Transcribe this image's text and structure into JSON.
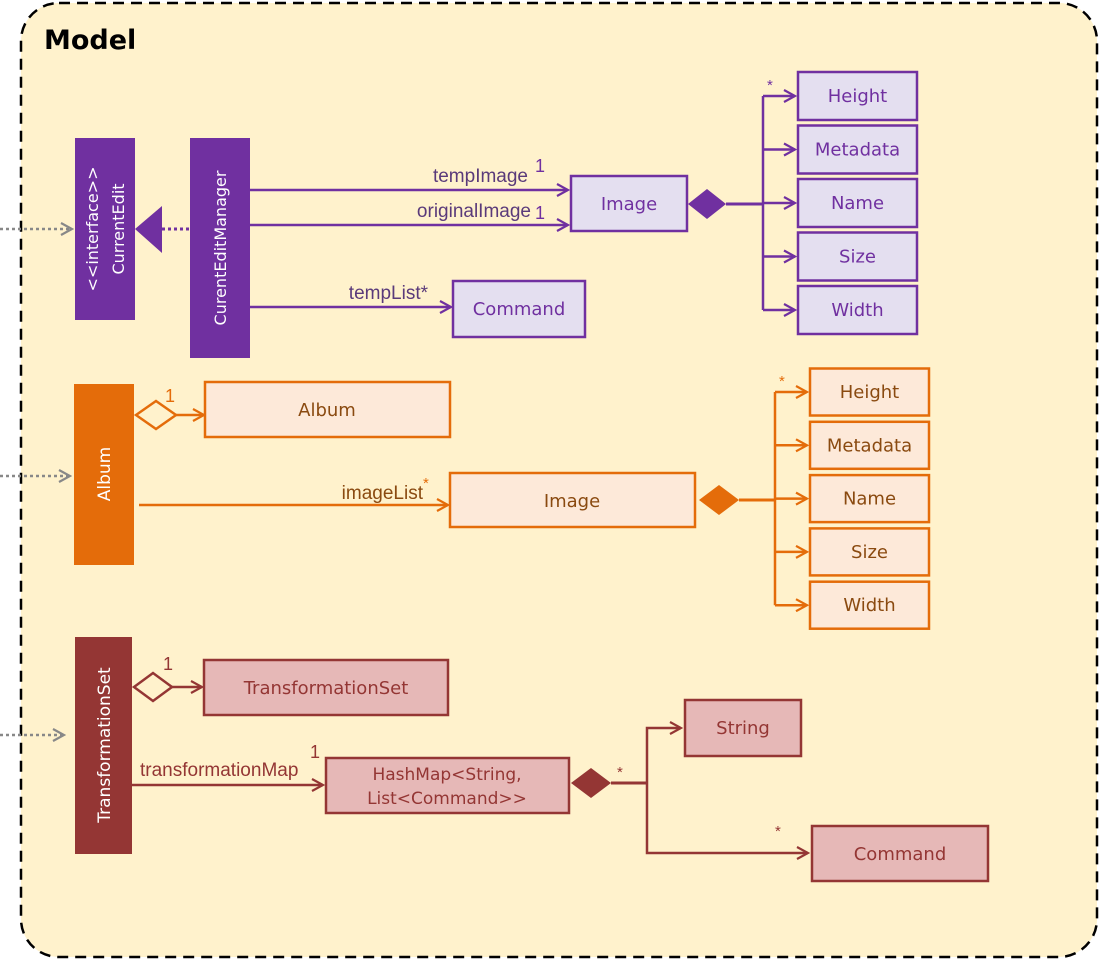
{
  "title": "Model",
  "colors": {
    "background": "#fff2cc",
    "border": "#000000",
    "external_arrow": "#888888",
    "purple": "#7030a0",
    "purple_fill": "#e4dff0",
    "purple_text": "#7030a0",
    "purple_label": "#5a3a7a",
    "orange": "#e46c0a",
    "orange_fill": "#fde9d9",
    "orange_text": "#8a4a10",
    "red": "#943634",
    "red_fill": "#e6b8b7",
    "red_text": "#943634"
  },
  "sections": {
    "current_edit": {
      "interface": {
        "stereotype": "<<interface>>",
        "name": "CurrentEdit"
      },
      "manager": {
        "name": "CurentEditManager"
      },
      "image": {
        "name": "Image"
      },
      "command": {
        "name": "Command"
      },
      "assoc_temp_image": {
        "label": "tempImage",
        "multiplicity": "1"
      },
      "assoc_original_image": {
        "label": "originalImage",
        "multiplicity": "1"
      },
      "assoc_temp_list": {
        "label": "tempList*"
      },
      "attributes_multiplicity": "*",
      "attributes": [
        "Height",
        "Metadata",
        "Name",
        "Size",
        "Width"
      ]
    },
    "album": {
      "owner": {
        "name": "Album"
      },
      "album": {
        "name": "Album"
      },
      "album_multiplicity": "1",
      "image": {
        "name": "Image"
      },
      "assoc_image_list": {
        "label": "imageList",
        "multiplicity": "*"
      },
      "attributes_multiplicity": "*",
      "attributes": [
        "Height",
        "Metadata",
        "Name",
        "Size",
        "Width"
      ]
    },
    "transformation": {
      "owner": {
        "name": "TransformationSet"
      },
      "set": {
        "name": "TransformationSet"
      },
      "set_multiplicity": "1",
      "map": {
        "line1": "HashMap<String,",
        "line2": "List<Command>>"
      },
      "assoc_map": {
        "label": "transformationMap",
        "multiplicity": "1"
      },
      "map_multiplicity": "*",
      "string": {
        "name": "String"
      },
      "command": {
        "name": "Command"
      },
      "command_multiplicity": "*"
    }
  }
}
